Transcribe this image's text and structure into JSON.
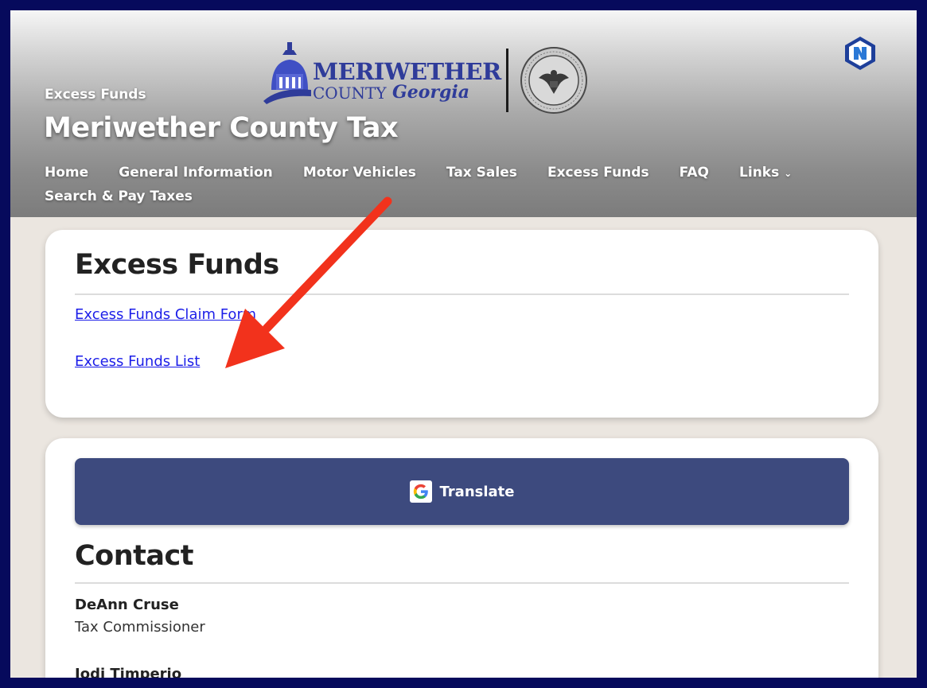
{
  "header": {
    "breadcrumb": "Excess Funds",
    "site_title": "Meriwether County Tax",
    "logo": {
      "line1": "MERIWETHER",
      "line2": "COUNTY",
      "line3": "Georgia"
    }
  },
  "nav": {
    "items": [
      {
        "label": "Home"
      },
      {
        "label": "General Information"
      },
      {
        "label": "Motor Vehicles"
      },
      {
        "label": "Tax Sales"
      },
      {
        "label": "Excess Funds"
      },
      {
        "label": "FAQ"
      },
      {
        "label": "Links",
        "has_dropdown": true
      }
    ],
    "row2": [
      {
        "label": "Search & Pay Taxes"
      }
    ]
  },
  "excess_funds": {
    "heading": "Excess Funds",
    "links": [
      {
        "label": "Excess Funds Claim Form"
      },
      {
        "label": "Excess Funds List"
      }
    ]
  },
  "translate": {
    "label": "Translate",
    "icon": "google-g-icon"
  },
  "contact": {
    "heading": "Contact",
    "people": [
      {
        "name": "DeAnn Cruse",
        "role": "Tax Commissioner"
      },
      {
        "name": "Jodi Timperio",
        "role": ""
      }
    ]
  },
  "colors": {
    "link": "#1c1ee8",
    "button": "#3d4a7e",
    "annotation_arrow": "#f2321c",
    "frame": "#060a5c",
    "logo_blue": "#2f3c9a"
  }
}
